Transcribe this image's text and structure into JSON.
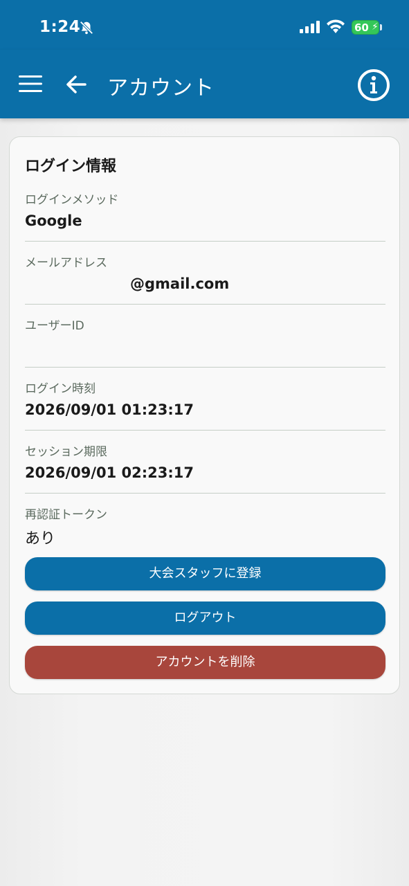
{
  "status_bar": {
    "time": "1:24",
    "battery_level": "60",
    "bell_icon": "bell-slash-icon",
    "signal_icon": "cellular-signal-icon",
    "wifi_icon": "wifi-icon",
    "battery_icon": "battery-charging-icon"
  },
  "app_bar": {
    "title": "アカウント",
    "menu_icon": "hamburger-menu-icon",
    "back_icon": "arrow-left-icon",
    "info_icon": "info-circle-icon",
    "color": "#0b6fa8"
  },
  "card": {
    "title": "ログイン情報",
    "fields": [
      {
        "label": "ログインメソッド",
        "value": "Google"
      },
      {
        "label": "メールアドレス",
        "value": "@gmail.com"
      },
      {
        "label": "ユーザーID",
        "value": ""
      },
      {
        "label": "ログイン時刻",
        "value": "2026/09/01 01:23:17"
      },
      {
        "label": "セッション期限",
        "value": "2026/09/01 02:23:17"
      },
      {
        "label": "再認証トークン",
        "value": "あり"
      }
    ],
    "buttons": {
      "register_staff": "大会スタッフに登録",
      "logout": "ログアウト",
      "delete_account": "アカウントを削除"
    }
  },
  "colors": {
    "primary": "#0b6fa8",
    "danger": "#a8463c",
    "background": "#f3f3f3",
    "card": "#f9f9f9"
  }
}
